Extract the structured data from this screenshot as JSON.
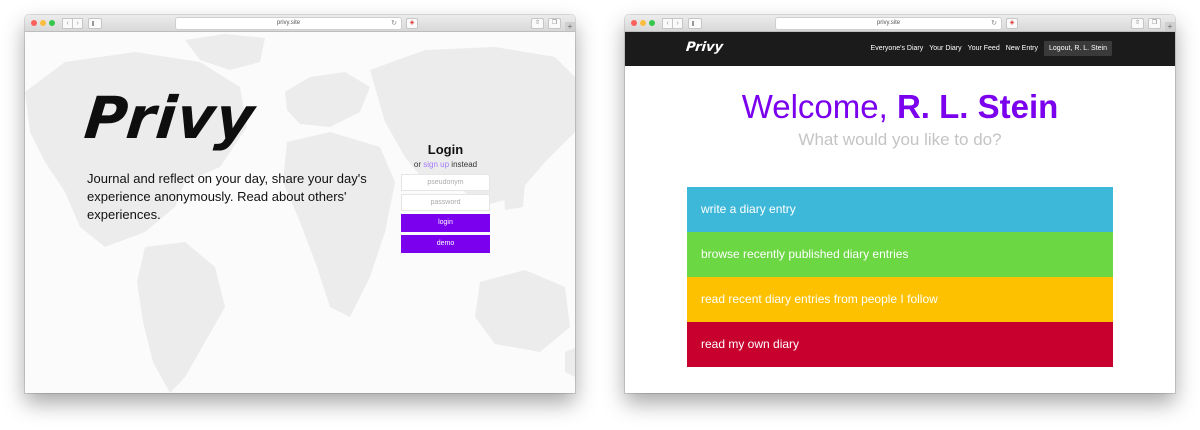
{
  "screens": {
    "login": {
      "chrome": {
        "url": "privy.site"
      },
      "logo": "Privy",
      "tagline": "Journal and reflect on your day, share your day's experience anonymously. Read about others' experiences.",
      "login_title": "Login",
      "signup_prefix": "or",
      "signup_link": "sign up",
      "signup_suffix": "instead",
      "pseudonym_placeholder": "pseudonym",
      "password_placeholder": "password",
      "login_button": "login",
      "demo_button": "demo"
    },
    "dashboard": {
      "chrome": {
        "url": "privy.site"
      },
      "logo": "Privy",
      "nav": {
        "everyones_diary": "Everyone's Diary",
        "your_diary": "Your Diary",
        "your_feed": "Your Feed",
        "new_entry": "New Entry",
        "logout": "Logout, R. L. Stein"
      },
      "welcome_prefix": "Welcome,",
      "user_name": "R. L. Stein",
      "subheading": "What would you like to do?",
      "actions": [
        {
          "label": "write a diary entry",
          "color": "#3db8d9"
        },
        {
          "label": "browse recently published diary entries",
          "color": "#6bd743"
        },
        {
          "label": "read recent diary entries from people I follow",
          "color": "#fdc100"
        },
        {
          "label": "read my own diary",
          "color": "#c8002e"
        }
      ]
    }
  },
  "colors": {
    "brand_purple": "#7a00ee",
    "signup_link": "#a27bff",
    "nav_bg": "#1b1b1b"
  }
}
